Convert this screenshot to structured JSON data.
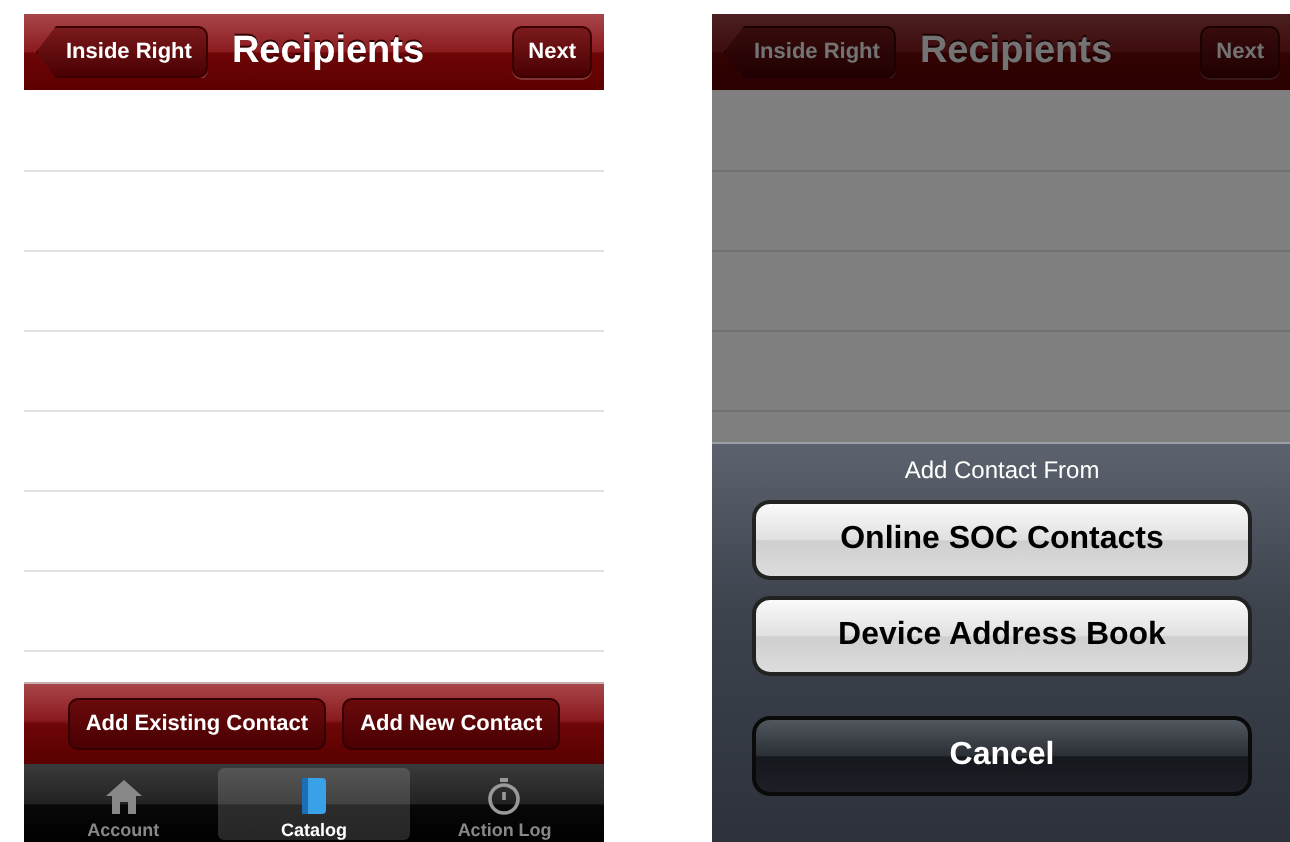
{
  "screens": [
    {
      "kind": "plain",
      "nav": {
        "back": "Inside Right",
        "title": "Recipients",
        "next": "Next"
      },
      "actions": [
        "Add Existing Contact",
        "Add New Contact"
      ],
      "tabs": [
        {
          "label": "Account",
          "kind": "house",
          "selected": false
        },
        {
          "label": "Catalog",
          "kind": "book",
          "selected": true
        },
        {
          "label": "Action Log",
          "kind": "stopwatch",
          "selected": false
        }
      ]
    },
    {
      "kind": "sheet",
      "nav": {
        "back": "Inside Right",
        "title": "Recipients",
        "next": "Next"
      },
      "sheet": {
        "title": "Add Contact From",
        "options": [
          "Online SOC Contacts",
          "Device Address Book"
        ],
        "cancel": "Cancel"
      }
    }
  ]
}
